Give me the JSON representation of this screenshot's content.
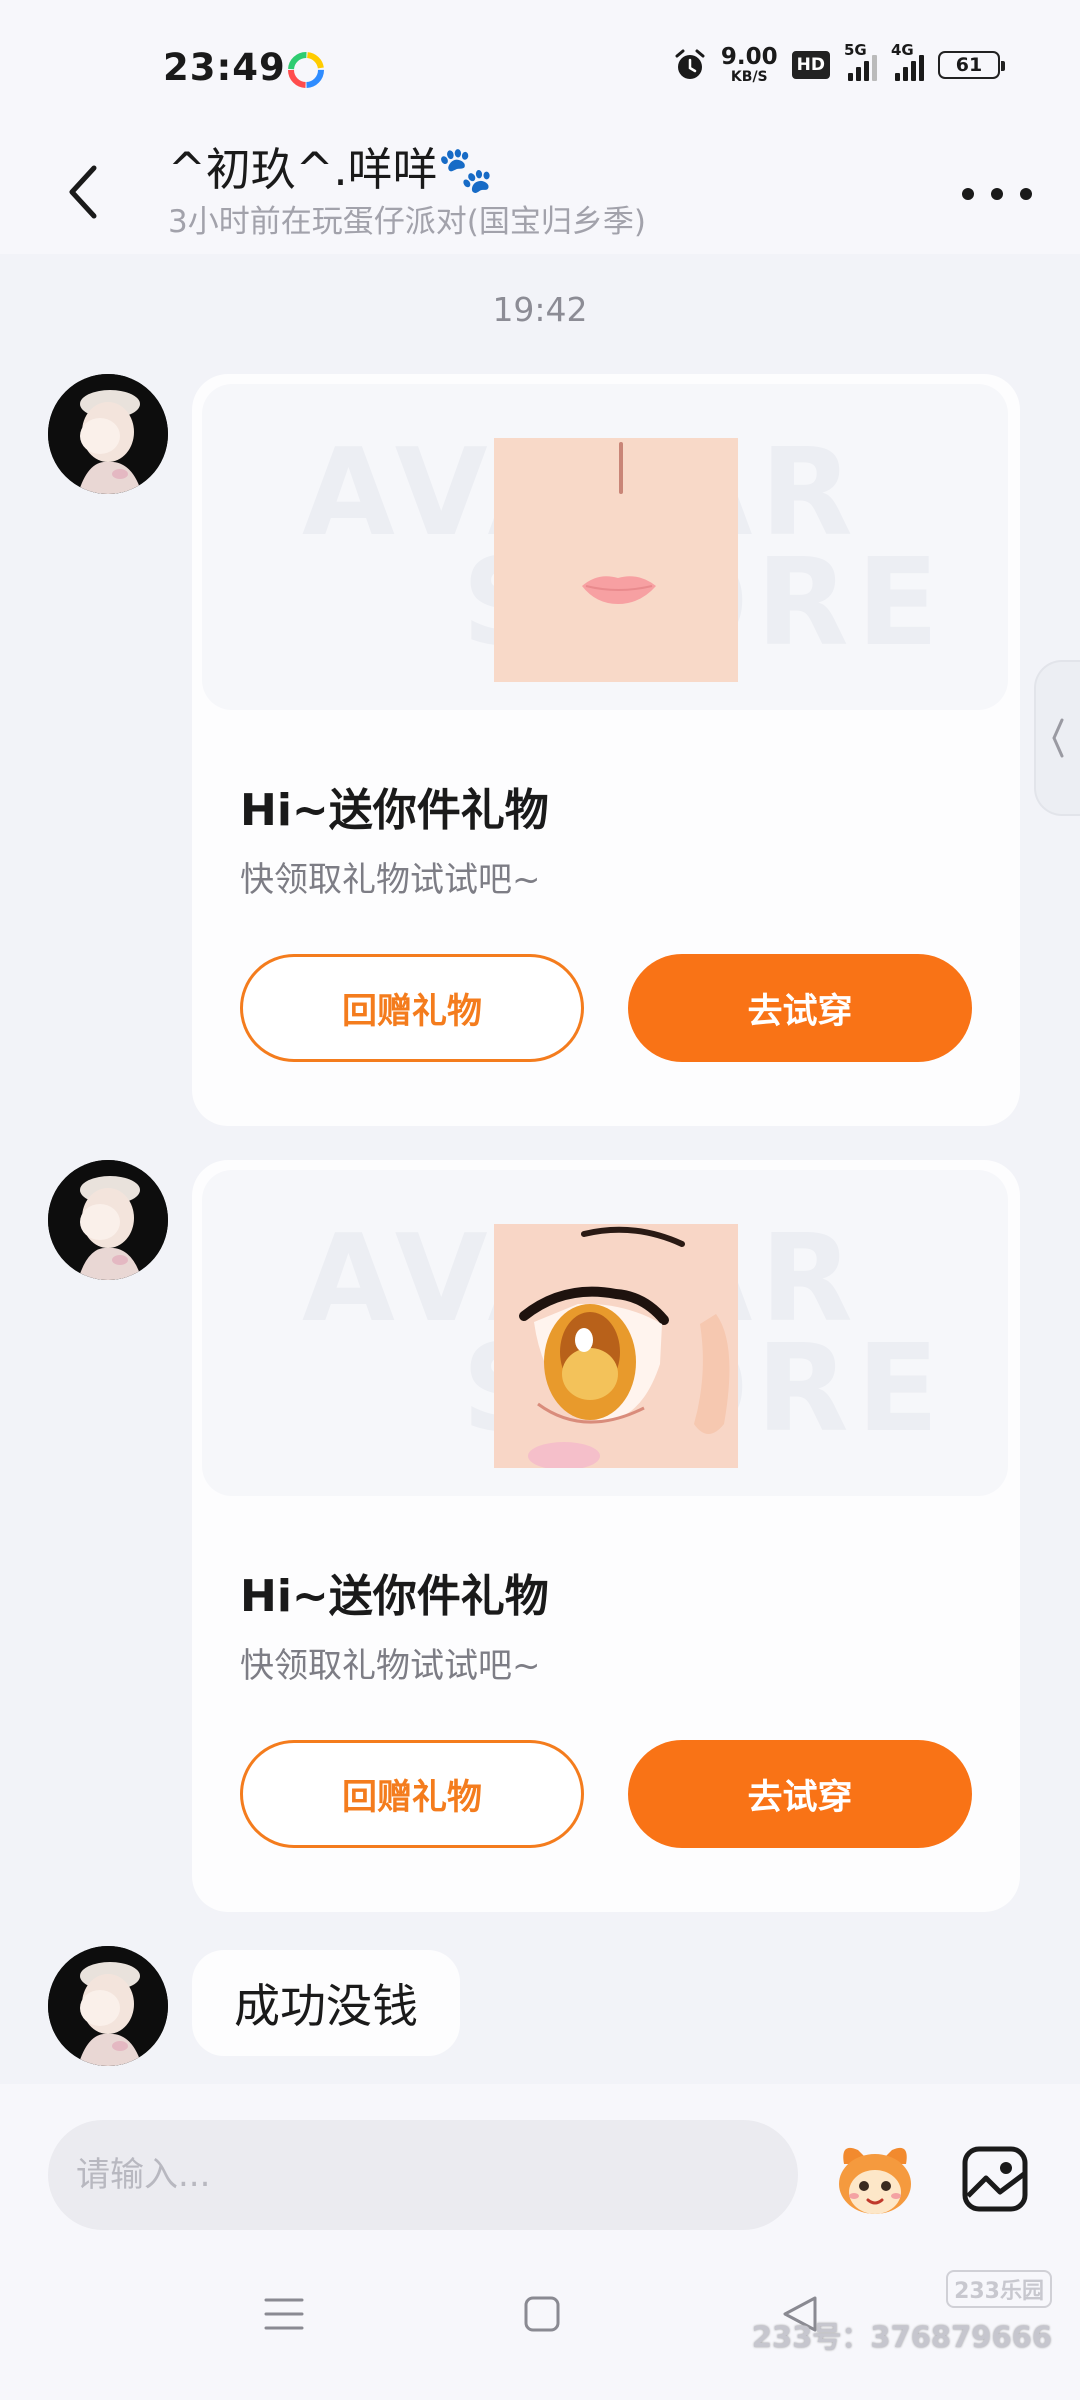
{
  "status_bar": {
    "time": "23:49",
    "net_speed_value": "9.00",
    "net_speed_unit": "KB/S",
    "hd_label": "HD",
    "sim1_label": "5G",
    "sim2_label": "4G",
    "battery": "61"
  },
  "header": {
    "title": "^初玖^.咩咩🐾",
    "subtitle": "3小时前在玩蛋仔派对(国宝归乡季)"
  },
  "chat": {
    "timestamp": "19:42",
    "messages": [
      {
        "type": "gift",
        "watermark_line1": "AVATAR",
        "watermark_line2": "STORE",
        "title": "Hi~送你件礼物",
        "description": "快领取礼物试试吧~",
        "secondary_button": "回赠礼物",
        "primary_button": "去试穿"
      },
      {
        "type": "gift",
        "watermark_line1": "AVATAR",
        "watermark_line2": "STORE",
        "title": "Hi~送你件礼物",
        "description": "快领取礼物试试吧~",
        "secondary_button": "回赠礼物",
        "primary_button": "去试穿"
      },
      {
        "type": "text",
        "text": "成功没钱"
      }
    ]
  },
  "input": {
    "placeholder": "请输入..."
  },
  "watermark": {
    "badge": "233乐园",
    "id_text": "233号：376879666"
  },
  "colors": {
    "accent": "#f97316",
    "background": "#f2f3f8",
    "card": "#fdfdfe"
  }
}
